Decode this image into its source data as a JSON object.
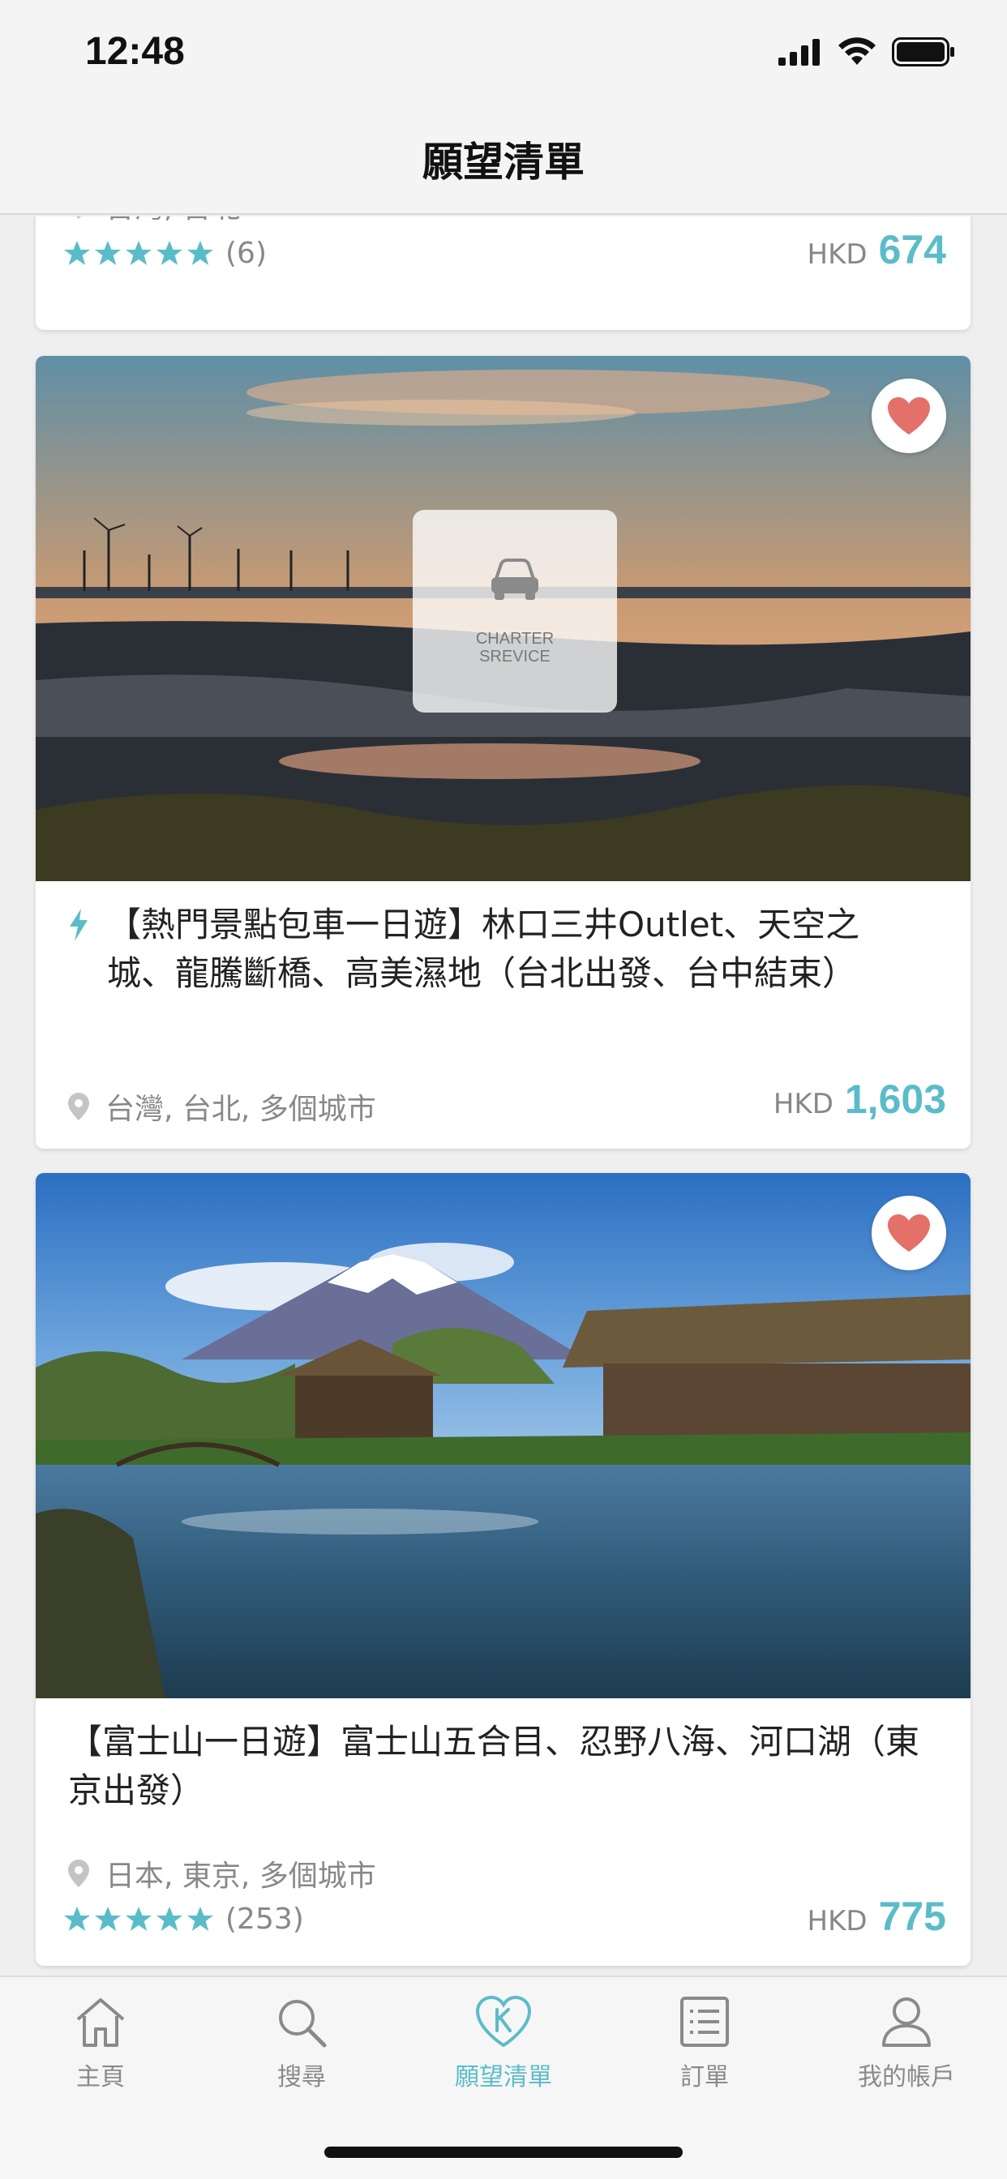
{
  "status_bar": {
    "time": "12:48"
  },
  "nav": {
    "title": "願望清單"
  },
  "cards": [
    {
      "location": "台灣, 台北",
      "rating_count": "(6)",
      "currency": "HKD",
      "price": "674"
    },
    {
      "title": "【熱門景點包車一日遊】林口三井Outlet、天空之城、龍騰斷橋、高美濕地（台北出發、台中結束）",
      "badge_label": "CHARTER\nSREVICE",
      "location": "台灣, 台北, 多個城市",
      "currency": "HKD",
      "price": "1,603"
    },
    {
      "title": "【富士山一日遊】富士山五合目、忍野八海、河口湖（東京出發）",
      "location": "日本, 東京, 多個城市",
      "rating_count": "(253)",
      "currency": "HKD",
      "price": "775"
    }
  ],
  "tabs": [
    {
      "label": "主頁",
      "icon": "home-icon"
    },
    {
      "label": "搜尋",
      "icon": "search-icon"
    },
    {
      "label": "願望清單",
      "icon": "wishlist-heart-icon",
      "active": true
    },
    {
      "label": "訂單",
      "icon": "orders-list-icon"
    },
    {
      "label": "我的帳戶",
      "icon": "account-icon"
    }
  ],
  "colors": {
    "accent": "#5bbcc9",
    "heart": "#e4706a",
    "star": "#5bbcc9"
  }
}
